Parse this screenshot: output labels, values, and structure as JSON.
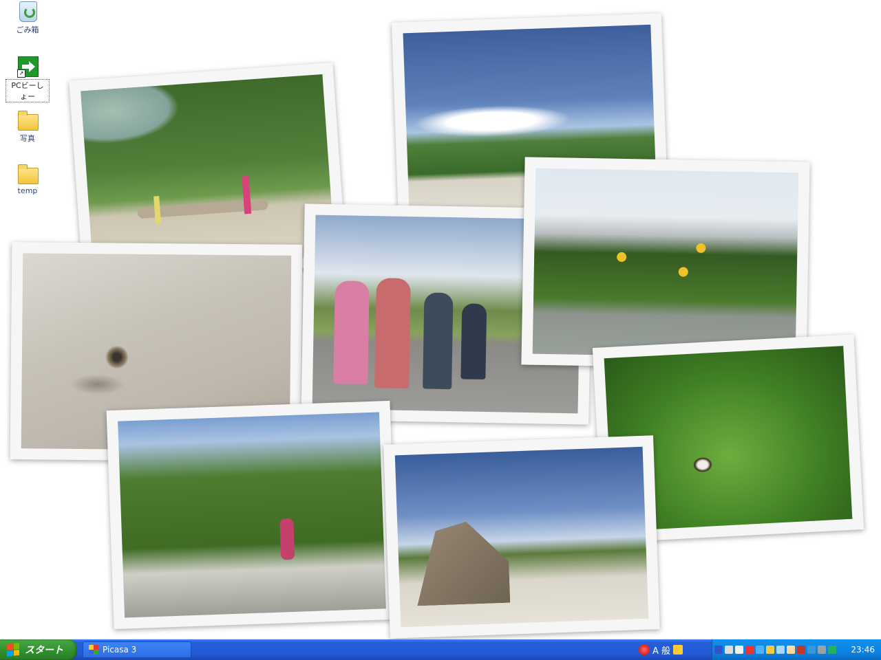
{
  "desktop": {
    "icons": [
      {
        "label": "ごみ箱",
        "icon": "recycle-bin-icon"
      },
      {
        "label": "PCビーしょー",
        "icon": "shortcut-icon"
      },
      {
        "label": "写真",
        "icon": "folder-icon"
      },
      {
        "label": "temp",
        "icon": "folder-icon"
      }
    ]
  },
  "photos": [
    {
      "subject": "beach trees"
    },
    {
      "subject": "sky over dunes"
    },
    {
      "subject": "butterfly on sand"
    },
    {
      "subject": "children on wall"
    },
    {
      "subject": "yellow flowers by building"
    },
    {
      "subject": "butterfly in greenery"
    },
    {
      "subject": "path through trees"
    },
    {
      "subject": "rock on beach"
    }
  ],
  "taskbar": {
    "start_label": "スタート",
    "window_title": "Picasa 3",
    "ime_text": "A 般",
    "clock": "23:46"
  },
  "colors": {
    "taskbar_blue": "#245edb",
    "start_green": "#2f8f2c",
    "tray_blue": "#0c7fdc"
  }
}
